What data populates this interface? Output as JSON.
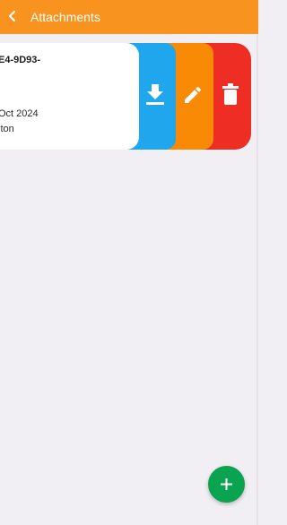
{
  "app_bar": {
    "title": "Attachments",
    "back_icon": "back-arrow-icon",
    "color": "#f7931e"
  },
  "attachment": {
    "id_text": "E4-9D93-",
    "date_text": "Oct 2024",
    "user_text": "lton"
  },
  "actions": {
    "download": {
      "icon": "download-icon",
      "color": "#1fa6ec"
    },
    "edit": {
      "icon": "edit-icon",
      "color": "#f98a06"
    },
    "delete": {
      "icon": "delete-icon",
      "color": "#ee2e24"
    }
  },
  "fab": {
    "icon": "plus-icon",
    "color": "#0aa34f"
  }
}
